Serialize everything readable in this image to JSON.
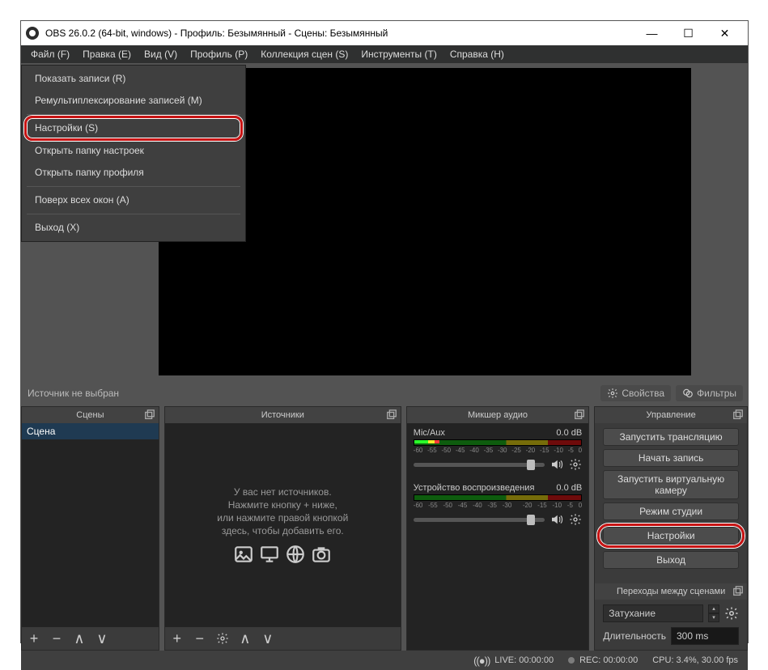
{
  "title": "OBS 26.0.2 (64-bit, windows) - Профиль: Безымянный - Сцены: Безымянный",
  "menus": {
    "file": "Файл (F)",
    "edit": "Правка (E)",
    "view": "Вид (V)",
    "profile": "Профиль (P)",
    "scene_collection": "Коллекция сцен (S)",
    "tools": "Инструменты (T)",
    "help": "Справка (H)"
  },
  "file_menu": {
    "show_recordings": "Показать записи (R)",
    "remux": "Ремультиплексирование записей (M)",
    "settings": "Настройки (S)",
    "open_settings_folder": "Открыть папку настроек",
    "open_profile_folder": "Открыть папку профиля",
    "always_on_top": "Поверх всех окон (A)",
    "exit": "Выход (X)"
  },
  "midbar": {
    "no_source": "Источник не выбран",
    "properties": "Свойства",
    "filters": "Фильтры"
  },
  "panels": {
    "scenes": "Сцены",
    "sources": "Источники",
    "mixer": "Микшер аудио",
    "controls": "Управление",
    "transitions": "Переходы между сценами"
  },
  "scenes": {
    "item0": "Сцена"
  },
  "sources_empty": {
    "l1": "У вас нет источников.",
    "l2": "Нажмите кнопку + ниже,",
    "l3": "или нажмите правой кнопкой",
    "l4": "здесь, чтобы добавить его."
  },
  "mixer": {
    "track1": {
      "name": "Mic/Aux",
      "level": "0.0 dB"
    },
    "track2": {
      "name": "Устройство воспроизведения",
      "level": "0.0 dB"
    },
    "ticks": {
      "t0": "-60",
      "t1": "-55",
      "t2": "-50",
      "t3": "-45",
      "t4": "-40",
      "t5": "-35",
      "t6": "-30",
      "t7": "-25",
      "t8": "-20",
      "t9": "-15",
      "t10": "-10",
      "t11": "-5",
      "t12": "0"
    }
  },
  "controls": {
    "start_stream": "Запустить трансляцию",
    "start_record": "Начать запись",
    "start_vcam": "Запустить виртуальную камеру",
    "studio_mode": "Режим студии",
    "settings": "Настройки",
    "exit": "Выход"
  },
  "transitions": {
    "selected": "Затухание",
    "duration_label": "Длительность",
    "duration_value": "300 ms"
  },
  "status": {
    "live": "LIVE: 00:00:00",
    "rec": "REC: 00:00:00",
    "cpu": "CPU: 3.4%, 30.00 fps"
  }
}
